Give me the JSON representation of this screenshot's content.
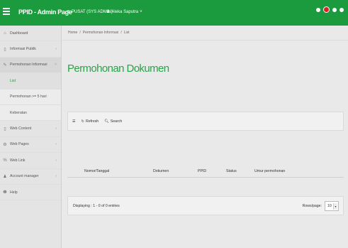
{
  "header": {
    "app_title": "PPID - Admin Page",
    "location": "PUSAT (SYS ADMIN)",
    "user": "Aleka Saputra"
  },
  "sidebar": {
    "items": [
      {
        "label": "Dashboard",
        "icon": "home-icon"
      },
      {
        "label": "Informasi Publik",
        "icon": "file-icon"
      },
      {
        "label": "Permohonan Informasi",
        "icon": "edit-icon"
      },
      {
        "label": "List"
      },
      {
        "label": "Permohonan >= 5 hari"
      },
      {
        "label": "Keberatan"
      },
      {
        "label": "Web Content",
        "icon": "file-icon"
      },
      {
        "label": "Web Pages",
        "icon": "gear-icon"
      },
      {
        "label": "Web Link",
        "icon": "link-icon"
      },
      {
        "label": "Account manager",
        "icon": "user-icon"
      },
      {
        "label": "Help",
        "icon": "info-icon"
      }
    ]
  },
  "breadcrumb": {
    "home": "Home",
    "section": "Permohonan Informasi",
    "current": "List"
  },
  "page": {
    "title": "Permohonan Dokumen"
  },
  "toolbar": {
    "refresh": "Refresh",
    "search": "Search"
  },
  "table": {
    "columns": [
      "Nomor/Tanggal",
      "Dokumen",
      "PPID",
      "Status",
      "Umur permohonan"
    ]
  },
  "footer": {
    "displaying": "Displaying : 1 - 0 of 0 entries",
    "rows_label": "Rows/page:",
    "rows_value": "10"
  }
}
